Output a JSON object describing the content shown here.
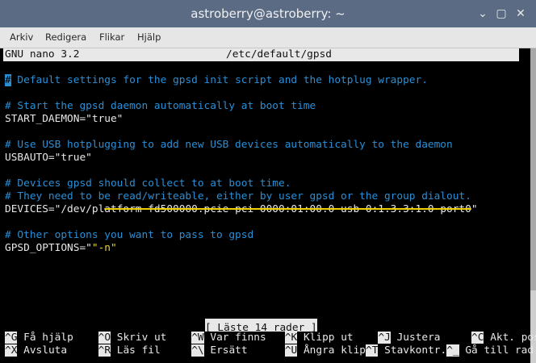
{
  "window": {
    "title": "astroberry@astroberry: ~",
    "buttons": {
      "min": "⌄",
      "max": "▢",
      "close": "✕"
    }
  },
  "menu": [
    "Arkiv",
    "Redigera",
    "Flikar",
    "Hjälp"
  ],
  "nano": {
    "header_left": "GNU nano 3.2",
    "header_file": "/etc/default/gpsd",
    "lines": {
      "l1_cursor": "#",
      "l1_rest": " Default settings for the gpsd init script and the hotplug wrapper.",
      "l2": "# Start the gpsd daemon automatically at boot time",
      "l3": "START_DAEMON=\"true\"",
      "l4": "# Use USB hotplugging to add new USB devices automatically to the daemon",
      "l5": "USBAUTO=\"true\"",
      "l6": "# Devices gpsd should collect to at boot time.",
      "l7": "# They need to be read/writeable, either by user gpsd or the group dialout.",
      "l8_pre": "DEVICES=\"/dev/pl",
      "l8_strike": "atform-fd500000.pcie-pci-0000:01:00.0-usb-0:1.3.3:1.0-port0",
      "l8_post": "\"",
      "l9": "# Other options you want to pass to gpsd",
      "l10_pre": "GPSD_OPTIONS=\"",
      "l10_mark": "\"-n\""
    },
    "status": "[ Läste 14 rader ]",
    "shortcuts": [
      {
        "key": "^G",
        "label": "Få hjälp"
      },
      {
        "key": "^O",
        "label": "Skriv ut"
      },
      {
        "key": "^W",
        "label": "Var finns"
      },
      {
        "key": "^K",
        "label": "Klipp ut"
      },
      {
        "key": "^J",
        "label": "Justera"
      },
      {
        "key": "^C",
        "label": "Akt. pos"
      },
      {
        "key": "^X",
        "label": "Avsluta"
      },
      {
        "key": "^R",
        "label": "Läs fil"
      },
      {
        "key": "^\\",
        "label": "Ersätt"
      },
      {
        "key": "^U",
        "label": "Ångra klip"
      },
      {
        "key": "^T",
        "label": "Stavkontr."
      },
      {
        "key": "^_",
        "label": "Gå till rad"
      }
    ]
  }
}
